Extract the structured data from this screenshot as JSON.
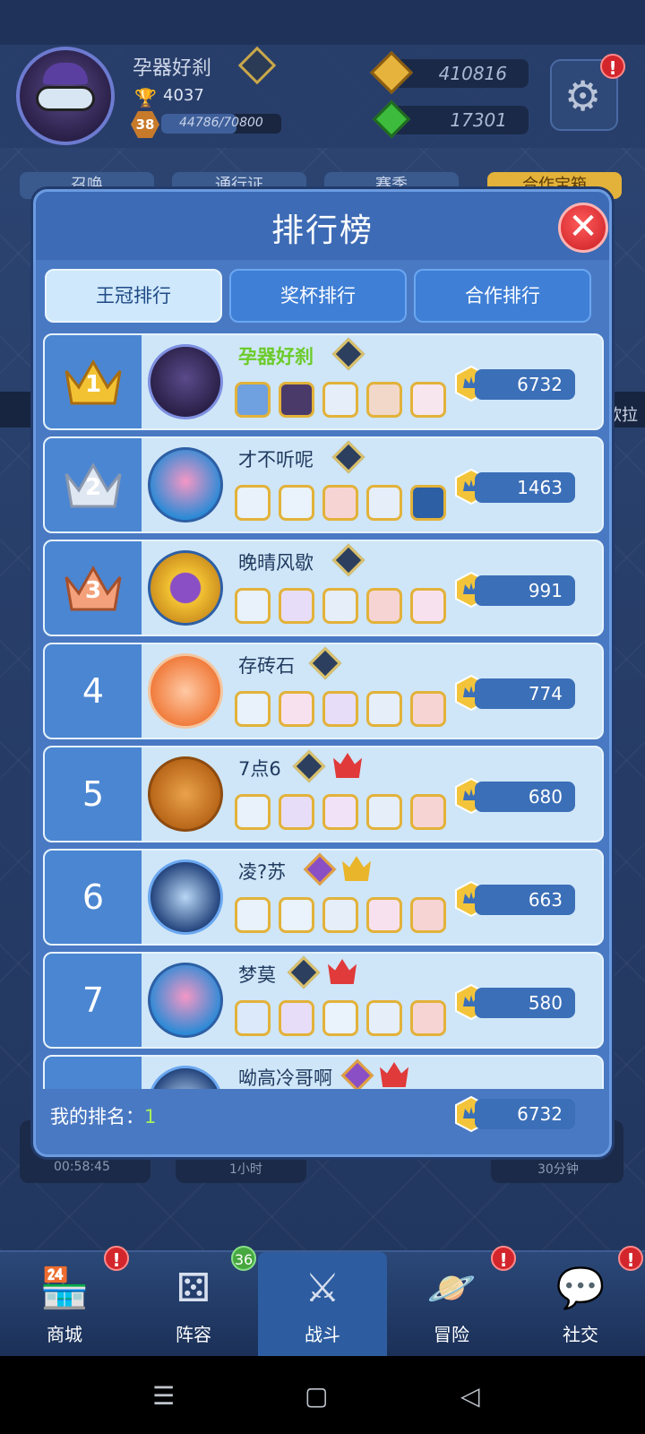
{
  "header": {
    "player_name": "孕器好刹",
    "trophies": "4037",
    "level": "38",
    "xp_text": "44786/70800",
    "xp_fraction": 0.63,
    "gold": "410816",
    "gems": "17301",
    "settings_alert": "!"
  },
  "background_tabs": [
    "召唤",
    "通行证",
    "赛季",
    "合作宝箱"
  ],
  "background_strip_text": "欧拉",
  "background_times": [
    "00:58:45",
    "1小时",
    "30分钟"
  ],
  "modal": {
    "title": "排行榜",
    "close_label": "✕",
    "tabs": [
      {
        "label": "王冠排行",
        "active": true
      },
      {
        "label": "奖杯排行",
        "active": false
      },
      {
        "label": "合作排行",
        "active": false
      }
    ],
    "rows": [
      {
        "rank": "1",
        "name": "孕器好刹",
        "score": "6732"
      },
      {
        "rank": "2",
        "name": "才不听呢",
        "score": "1463"
      },
      {
        "rank": "3",
        "name": "晚晴风歇",
        "score": "991"
      },
      {
        "rank": "4",
        "name": "存砖石",
        "score": "774"
      },
      {
        "rank": "5",
        "name": "7点6",
        "score": "680"
      },
      {
        "rank": "6",
        "name": "凌?苏",
        "score": "663"
      },
      {
        "rank": "7",
        "name": "梦莫",
        "score": "580"
      },
      {
        "rank": "",
        "name": "呦高冷哥啊",
        "score": ""
      }
    ],
    "my_rank_label": "我的排名：",
    "my_rank_value": "1",
    "my_score": "6732"
  },
  "bottom_nav": [
    {
      "label": "商城",
      "icon": "shop-icon",
      "alert": "!"
    },
    {
      "label": "阵容",
      "icon": "dice-icon",
      "badge": "36"
    },
    {
      "label": "战斗",
      "icon": "swords-icon",
      "active": true
    },
    {
      "label": "冒险",
      "icon": "planet-icon",
      "alert": "!"
    },
    {
      "label": "社交",
      "icon": "chat-icon",
      "alert": "!"
    }
  ],
  "colors": {
    "modal_bg": "#4a79c3",
    "row_bg": "#cfe6f8",
    "rank_col": "#4b86d2",
    "highlight_name": "#6ccb2a"
  }
}
